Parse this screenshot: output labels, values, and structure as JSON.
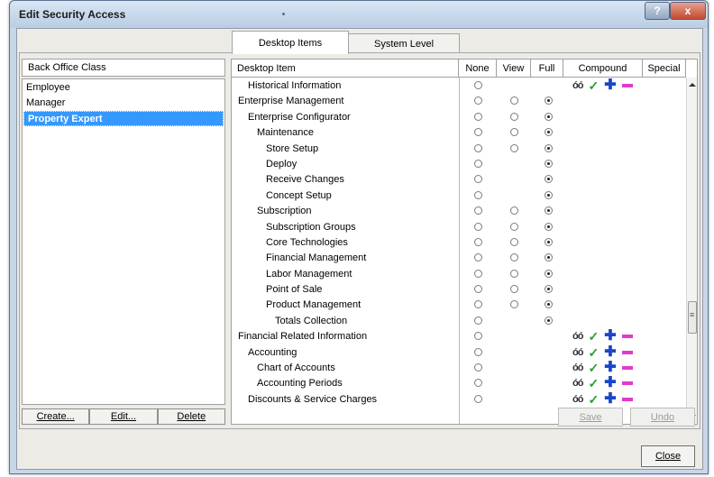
{
  "window": {
    "title": "Edit Security Access",
    "help_glyph": "?",
    "close_glyph": "x"
  },
  "tabs": [
    {
      "label": "Desktop Items",
      "active": true
    },
    {
      "label": "System Level",
      "active": false
    }
  ],
  "left": {
    "header": "Back Office Class",
    "items": [
      {
        "label": "Employee",
        "selected": false
      },
      {
        "label": "Manager",
        "selected": false
      },
      {
        "label": "Property Expert",
        "selected": true
      }
    ],
    "buttons": [
      "Create...",
      "Edit...",
      "Delete"
    ]
  },
  "grid": {
    "headers": {
      "item": "Desktop Item",
      "none": "None",
      "view": "View",
      "full": "Full",
      "compound": "Compound",
      "special": "Special"
    },
    "rows": [
      {
        "label": "Historical Information",
        "indent": 1,
        "radios": "none",
        "compound": true
      },
      {
        "label": "Enterprise Management",
        "indent": 0,
        "radios": "all",
        "selected": "full"
      },
      {
        "label": "Enterprise Configurator",
        "indent": 1,
        "radios": "all",
        "selected": "full"
      },
      {
        "label": "Maintenance",
        "indent": 2,
        "radios": "all",
        "selected": "full"
      },
      {
        "label": "Store Setup",
        "indent": 3,
        "radios": "all",
        "selected": "full"
      },
      {
        "label": "Deploy",
        "indent": 3,
        "radios": "nonefull",
        "selected": "full"
      },
      {
        "label": "Receive Changes",
        "indent": 3,
        "radios": "nonefull",
        "selected": "full"
      },
      {
        "label": "Concept Setup",
        "indent": 3,
        "radios": "nonefull",
        "selected": "full"
      },
      {
        "label": "Subscription",
        "indent": 2,
        "radios": "all",
        "selected": "full"
      },
      {
        "label": "Subscription Groups",
        "indent": 3,
        "radios": "all",
        "selected": "full"
      },
      {
        "label": "Core Technologies",
        "indent": 3,
        "radios": "all",
        "selected": "full"
      },
      {
        "label": "Financial Management",
        "indent": 3,
        "radios": "all",
        "selected": "full"
      },
      {
        "label": "Labor Management",
        "indent": 3,
        "radios": "all",
        "selected": "full"
      },
      {
        "label": "Point of Sale",
        "indent": 3,
        "radios": "all",
        "selected": "full"
      },
      {
        "label": "Product Management",
        "indent": 3,
        "radios": "all",
        "selected": "full"
      },
      {
        "label": "Totals Collection",
        "indent": 4,
        "radios": "nonefull",
        "selected": "full"
      },
      {
        "label": "Financial Related Information",
        "indent": 0,
        "radios": "none",
        "compound": true
      },
      {
        "label": "Accounting",
        "indent": 1,
        "radios": "none",
        "compound": true
      },
      {
        "label": "Chart of Accounts",
        "indent": 2,
        "radios": "none",
        "compound": true
      },
      {
        "label": "Accounting Periods",
        "indent": 2,
        "radios": "none",
        "compound": true
      },
      {
        "label": "Discounts & Service Charges",
        "indent": 1,
        "radios": "none",
        "compound": true
      }
    ]
  },
  "actions": {
    "save": "Save",
    "undo": "Undo",
    "close": "Close"
  },
  "icons": {
    "view": "glasses-icon",
    "check": "check-icon",
    "add": "plus-icon",
    "remove": "minus-icon"
  }
}
